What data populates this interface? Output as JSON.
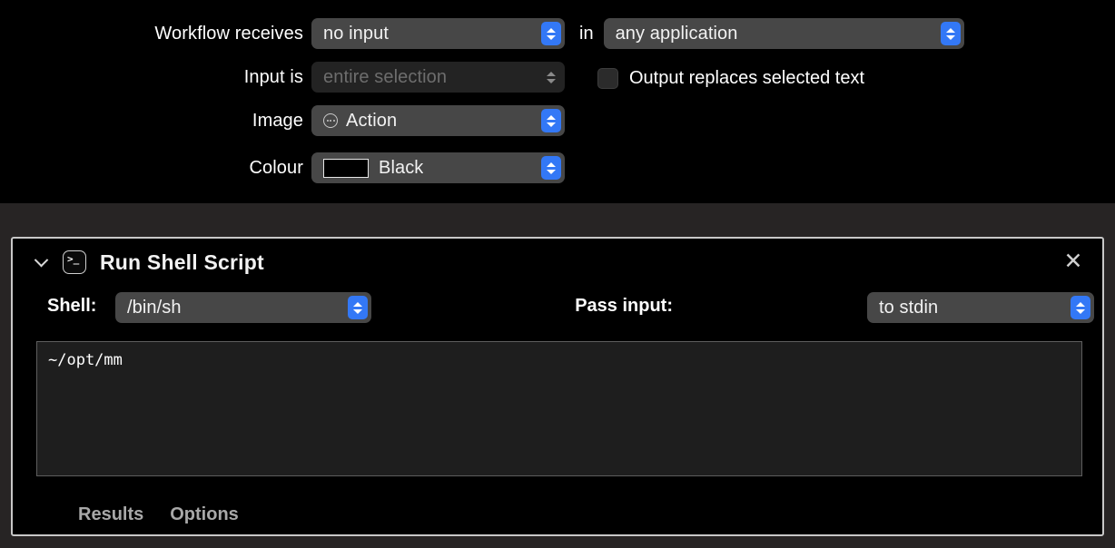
{
  "config": {
    "rows": [
      {
        "label": "Workflow receives",
        "value": "no input",
        "disabled": false
      },
      {
        "label": "Input is",
        "value": "entire selection",
        "disabled": true
      },
      {
        "label": "Image",
        "value": "Action",
        "disabled": false
      },
      {
        "label": "Colour",
        "value": "Black",
        "disabled": false
      }
    ],
    "in_label": "in",
    "application_value": "any application",
    "output_checkbox_label": "Output replaces selected text",
    "output_checkbox_checked": false,
    "colour_swatch_hex": "#000000",
    "accent_hex": "#3378f6"
  },
  "action": {
    "title": "Run Shell Script",
    "terminal_prompt": ">_",
    "close_label": "✕",
    "shell_label": "Shell:",
    "shell_value": "/bin/sh",
    "pass_input_label": "Pass input:",
    "pass_input_value": "to stdin",
    "script": "~/opt/mm",
    "tabs": [
      {
        "label": "Results"
      },
      {
        "label": "Options"
      }
    ]
  }
}
